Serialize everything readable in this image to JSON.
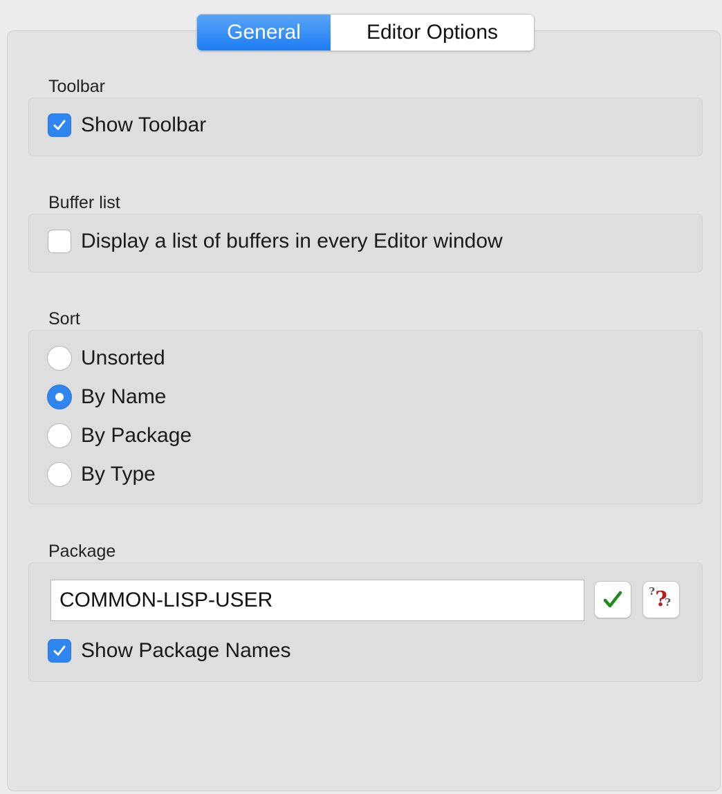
{
  "tabs": [
    {
      "label": "General",
      "selected": true
    },
    {
      "label": "Editor Options",
      "selected": false
    }
  ],
  "toolbar": {
    "section_label": "Toolbar",
    "show_toolbar": {
      "label": "Show Toolbar",
      "checked": true
    }
  },
  "buffer_list": {
    "section_label": "Buffer list",
    "display_list": {
      "label": "Display a list of buffers in every Editor window",
      "checked": false
    }
  },
  "sort": {
    "section_label": "Sort",
    "options": [
      {
        "label": "Unsorted",
        "selected": false
      },
      {
        "label": "By Name",
        "selected": true
      },
      {
        "label": "By Package",
        "selected": false
      },
      {
        "label": "By Type",
        "selected": false
      }
    ]
  },
  "package": {
    "section_label": "Package",
    "input_value": "COMMON-LISP-USER",
    "confirm_icon": "checkmark-icon",
    "help_icon": "question-mark-icon",
    "show_package_names": {
      "label": "Show Package Names",
      "checked": true
    }
  },
  "colors": {
    "accent": "#2f86f0",
    "confirm_green": "#1f8a1f",
    "help_red": "#c01818"
  }
}
